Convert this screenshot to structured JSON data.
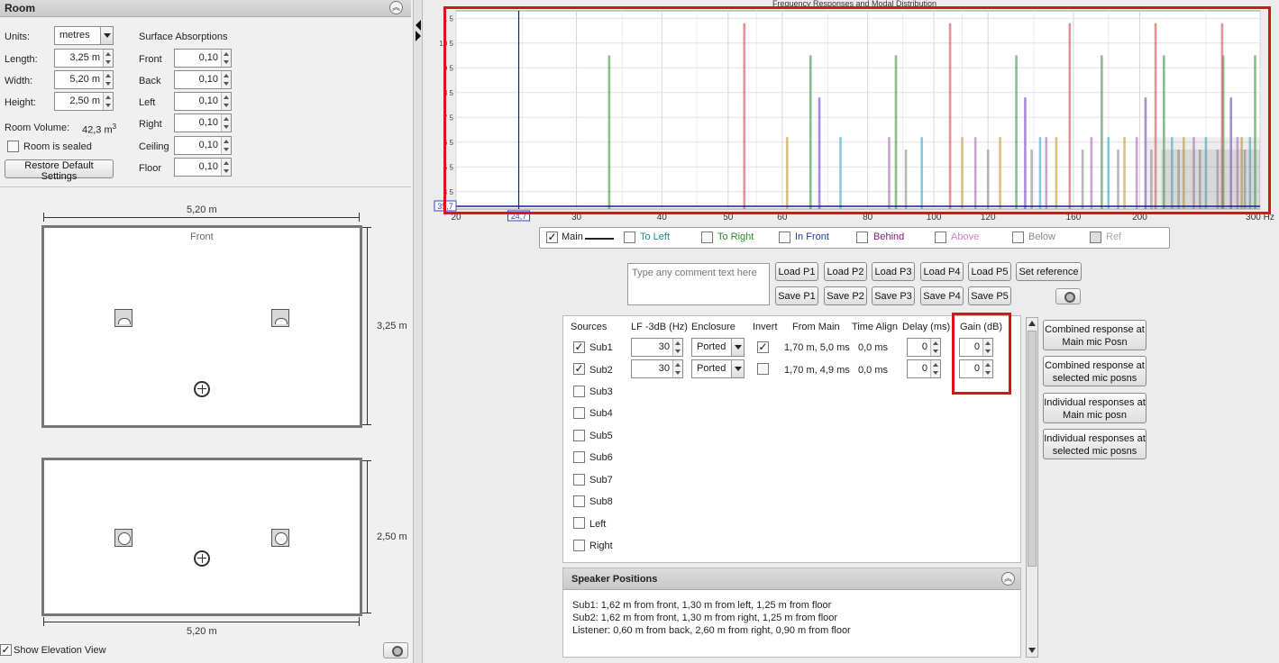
{
  "room": {
    "title": "Room",
    "units_label": "Units:",
    "units_value": "metres",
    "length_label": "Length:",
    "length_value": "3,25 m",
    "width_label": "Width:",
    "width_value": "5,20 m",
    "height_label": "Height:",
    "height_value": "2,50 m",
    "volume_label": "Room Volume:",
    "volume_value": "42,3 m",
    "volume_sup": "3",
    "sealed_label": "Room is sealed",
    "restore_label": "Restore Default Settings",
    "absorptions_title": "Surface Absorptions",
    "surfaces": [
      {
        "label": "Front",
        "value": "0,10"
      },
      {
        "label": "Back",
        "value": "0,10"
      },
      {
        "label": "Left",
        "value": "0,10"
      },
      {
        "label": "Right",
        "value": "0,10"
      },
      {
        "label": "Ceiling",
        "value": "0,10"
      },
      {
        "label": "Floor",
        "value": "0,10"
      }
    ]
  },
  "plan": {
    "top_width": "5,20 m",
    "front_label": "Front",
    "side_depth": "3,25 m",
    "elev_height": "2,50 m",
    "bottom_width": "5,20 m",
    "show_elevation_label": "Show Elevation View"
  },
  "chart_data": {
    "type": "bar",
    "title": "Frequency Responses and Modal Distribution",
    "x_ticks": [
      "20",
      "30",
      "40",
      "50",
      "60",
      "80",
      "100",
      "120",
      "160",
      "200",
      "300 Hz"
    ],
    "y_ticks": [
      "1 5",
      "10 5",
      "9 5",
      "8 5",
      "7 5",
      "6 5",
      "5 5",
      "4 5"
    ],
    "y_value_label": "39,7",
    "x_marker_label": "24,7",
    "x_marker_value": 24.7,
    "xlim": [
      20,
      300
    ],
    "xscale": "log",
    "ylim": [
      0,
      8
    ],
    "grid": true,
    "series": [
      {
        "color": "#4a9a4a",
        "values": [
          [
            33.5,
            6.2
          ],
          [
            66,
            6.2
          ],
          [
            88,
            6.2
          ],
          [
            132,
            6.2
          ],
          [
            176,
            6.2
          ],
          [
            217,
            6.2
          ],
          [
            265,
            6.2
          ],
          [
            295,
            6.2
          ]
        ]
      },
      {
        "color": "#d05a5a",
        "values": [
          [
            52.8,
            7.5
          ],
          [
            105.6,
            7.5
          ],
          [
            158,
            7.5
          ],
          [
            211,
            7.5
          ],
          [
            264,
            7.5
          ]
        ]
      },
      {
        "color": "#7a4fc0",
        "values": [
          [
            68,
            4.5
          ],
          [
            136,
            4.5
          ],
          [
            204,
            4.5
          ],
          [
            272,
            4.5
          ]
        ]
      },
      {
        "color": "#c8a040",
        "values": [
          [
            61,
            2.9
          ],
          [
            110,
            2.9
          ],
          [
            125,
            2.9
          ],
          [
            151,
            2.9
          ],
          [
            190,
            2.9
          ],
          [
            232,
            2.9
          ],
          [
            282,
            2.9
          ]
        ]
      },
      {
        "color": "#40b0c8",
        "values": [
          [
            73,
            2.9
          ],
          [
            96,
            2.9
          ],
          [
            143,
            2.9
          ],
          [
            180,
            2.9
          ],
          [
            223,
            2.9
          ],
          [
            250,
            2.9
          ],
          [
            290,
            2.9
          ]
        ]
      },
      {
        "color": "#b070c0",
        "values": [
          [
            86,
            2.9
          ],
          [
            115,
            2.9
          ],
          [
            146,
            2.9
          ],
          [
            170,
            2.9
          ],
          [
            198,
            2.9
          ],
          [
            240,
            2.9
          ],
          [
            278,
            2.9
          ]
        ]
      },
      {
        "color": "#909090",
        "values": [
          [
            91,
            2.4
          ],
          [
            120,
            2.4
          ],
          [
            139,
            2.4
          ],
          [
            165,
            2.4
          ],
          [
            186,
            2.4
          ],
          [
            208,
            2.4
          ],
          [
            228,
            2.4
          ],
          [
            245,
            2.4
          ],
          [
            260,
            2.4
          ],
          [
            285,
            2.4
          ]
        ]
      }
    ]
  },
  "legend": {
    "items": [
      {
        "label": "Main",
        "checked": "✓",
        "color": "#222222"
      },
      {
        "label": "To Left",
        "checked": "",
        "color": "#1a8a8a"
      },
      {
        "label": "To Right",
        "checked": "",
        "color": "#2a8a2a"
      },
      {
        "label": "In Front",
        "checked": "",
        "color": "#1a3a9a"
      },
      {
        "label": "Behind",
        "checked": "",
        "color": "#8a1a8a"
      },
      {
        "label": "Above",
        "checked": "",
        "color": "#d080d0"
      },
      {
        "label": "Below",
        "checked": "",
        "color": "#888888"
      },
      {
        "label": "Ref",
        "checked": "",
        "color": "#aaaaaa"
      }
    ]
  },
  "comment": {
    "placeholder": "Type any comment text here"
  },
  "presets": {
    "load": [
      "Load P1",
      "Load P2",
      "Load P3",
      "Load P4",
      "Load P5"
    ],
    "save": [
      "Save P1",
      "Save P2",
      "Save P3",
      "Save P4",
      "Save P5"
    ],
    "set_reference": "Set reference"
  },
  "sources": {
    "headers": {
      "sources": "Sources",
      "lf": "LF -3dB (Hz)",
      "enclosure": "Enclosure",
      "invert": "Invert",
      "from_main": "From Main",
      "time_align": "Time Align",
      "delay": "Delay (ms)",
      "gain": "Gain (dB)"
    },
    "active": [
      {
        "name": "Sub1",
        "checked": "✓",
        "lf": "30",
        "enclosure": "Ported",
        "invert": "✓",
        "from_main": "1,70 m, 5,0 ms",
        "time_align": "0,0 ms",
        "delay": "0",
        "gain": "0"
      },
      {
        "name": "Sub2",
        "checked": "✓",
        "lf": "30",
        "enclosure": "Ported",
        "invert": "",
        "from_main": "1,70 m, 4,9 ms",
        "time_align": "0,0 ms",
        "delay": "0",
        "gain": "0"
      }
    ],
    "inactive": [
      "Sub3",
      "Sub4",
      "Sub5",
      "Sub6",
      "Sub7",
      "Sub8",
      "Left",
      "Right"
    ]
  },
  "response_buttons": [
    {
      "line1": "Combined response at",
      "line2": "Main mic Posn"
    },
    {
      "line1": "Combined response at",
      "line2": "selected mic posns"
    },
    {
      "line1": "Individual responses at",
      "line2": "Main mic posn"
    },
    {
      "line1": "Individual responses at",
      "line2": "selected mic posns"
    }
  ],
  "speaker_positions": {
    "title": "Speaker Positions",
    "lines": [
      "Sub1: 1,62 m from front, 1,30 m from left, 1,25 m from floor",
      "Sub2: 1,62 m from front, 1,30 m from right, 1,25 m from floor",
      "Listener: 0,60 m from back, 2,60 m from right, 0,90 m from floor"
    ]
  },
  "colors": {
    "highlight": "#d8141d",
    "main_marker": "#1a1a8a"
  }
}
